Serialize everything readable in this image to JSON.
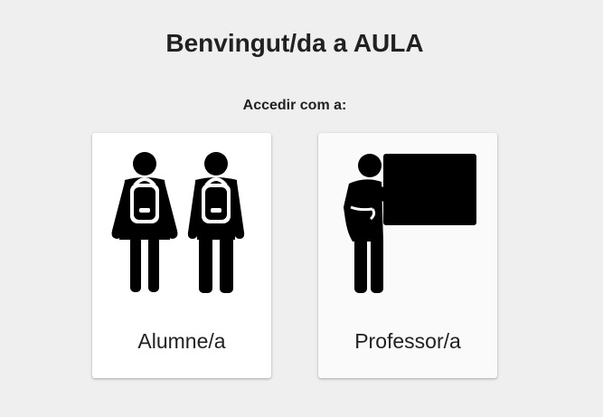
{
  "header": {
    "title": "Benvingut/da a AULA",
    "subtitle": "Accedir com a:"
  },
  "options": [
    {
      "label": "Alumne/a",
      "icon": "students-icon"
    },
    {
      "label": "Professor/a",
      "icon": "teacher-icon"
    }
  ],
  "colors": {
    "background": "#efefef",
    "card": "#ffffff",
    "text": "#212121",
    "icon": "#000000"
  }
}
